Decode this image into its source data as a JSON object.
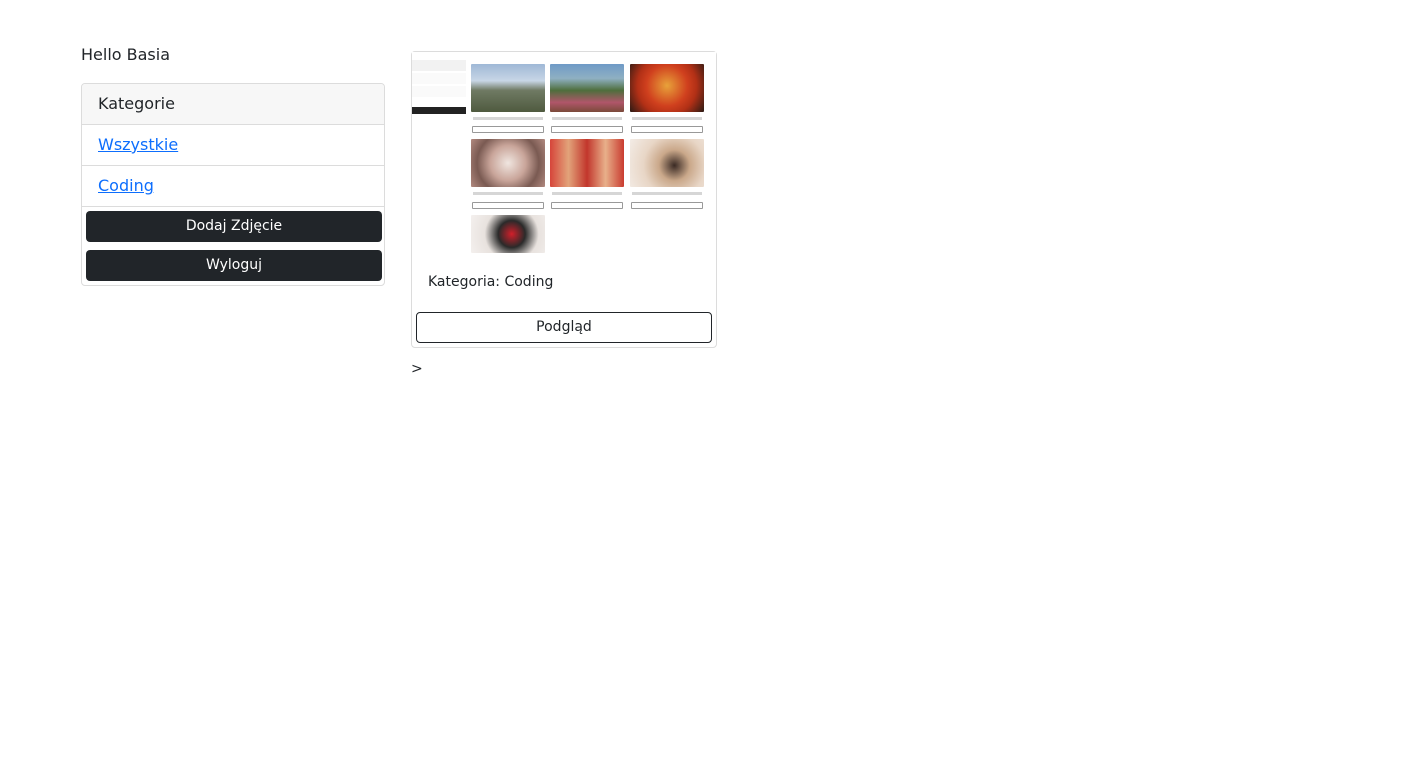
{
  "greeting": "Hello Basia",
  "sidebar": {
    "header": "Kategorie",
    "items": [
      {
        "label": "Wszystkie"
      },
      {
        "label": "Coding"
      }
    ],
    "add_photo_label": "Dodaj Zdjęcie",
    "logout_label": "Wyloguj"
  },
  "photo_card": {
    "caption": "Kategoria: Coding",
    "preview_label": "Podgląd"
  },
  "stray_text": ">"
}
